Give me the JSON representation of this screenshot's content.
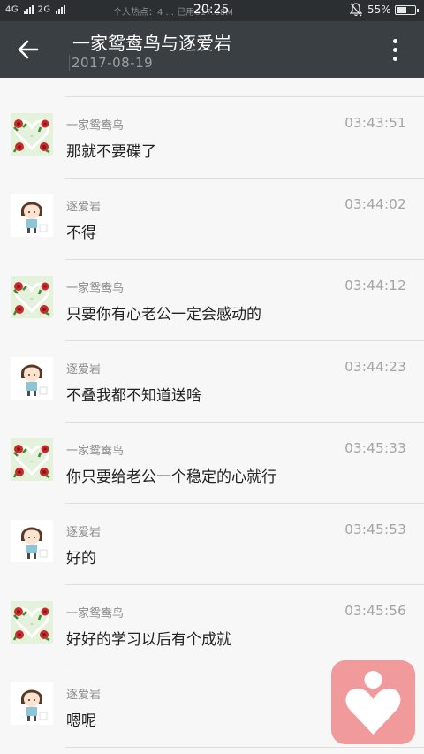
{
  "status_bar": {
    "network": "4G",
    "network2": "2G",
    "notice": "个人热点：4 ... 已用617.68M",
    "clock": "20:25",
    "battery": "55%",
    "battery_level": 0.55,
    "mute_icon": "bell-slash-icon"
  },
  "app_bar": {
    "title": "一家鸳鸯鸟与逐爱岩",
    "subtitle": "2017-08-19",
    "back_icon": "arrow-left-icon",
    "more_icon": "more-vertical-icon"
  },
  "messages": [
    {
      "sender": "一家鸳鸯鸟",
      "time": "03:43:51",
      "text": "那就不要碟了",
      "avatar": "rose-heart-avatar"
    },
    {
      "sender": "逐爱岩",
      "time": "03:44:02",
      "text": "不得",
      "avatar": "cartoon-girl-avatar"
    },
    {
      "sender": "一家鸳鸯鸟",
      "time": "03:44:12",
      "text": "只要你有心老公一定会感动的",
      "avatar": "rose-heart-avatar"
    },
    {
      "sender": "逐爱岩",
      "time": "03:44:23",
      "text": "不叠我都不知道送啥",
      "avatar": "cartoon-girl-avatar"
    },
    {
      "sender": "一家鸳鸯鸟",
      "time": "03:45:33",
      "text": "你只要给老公一个稳定的心就行",
      "avatar": "rose-heart-avatar"
    },
    {
      "sender": "逐爱岩",
      "time": "03:45:53",
      "text": "好的",
      "avatar": "cartoon-girl-avatar"
    },
    {
      "sender": "一家鸳鸯鸟",
      "time": "03:45:56",
      "text": "好好的学习以后有个成就",
      "avatar": "rose-heart-avatar"
    },
    {
      "sender": "逐爱岩",
      "time": "",
      "text": "嗯呢",
      "avatar": "cartoon-girl-avatar"
    }
  ],
  "floating_button": {
    "icon": "heart-person-icon",
    "color": "#f19a9b"
  }
}
